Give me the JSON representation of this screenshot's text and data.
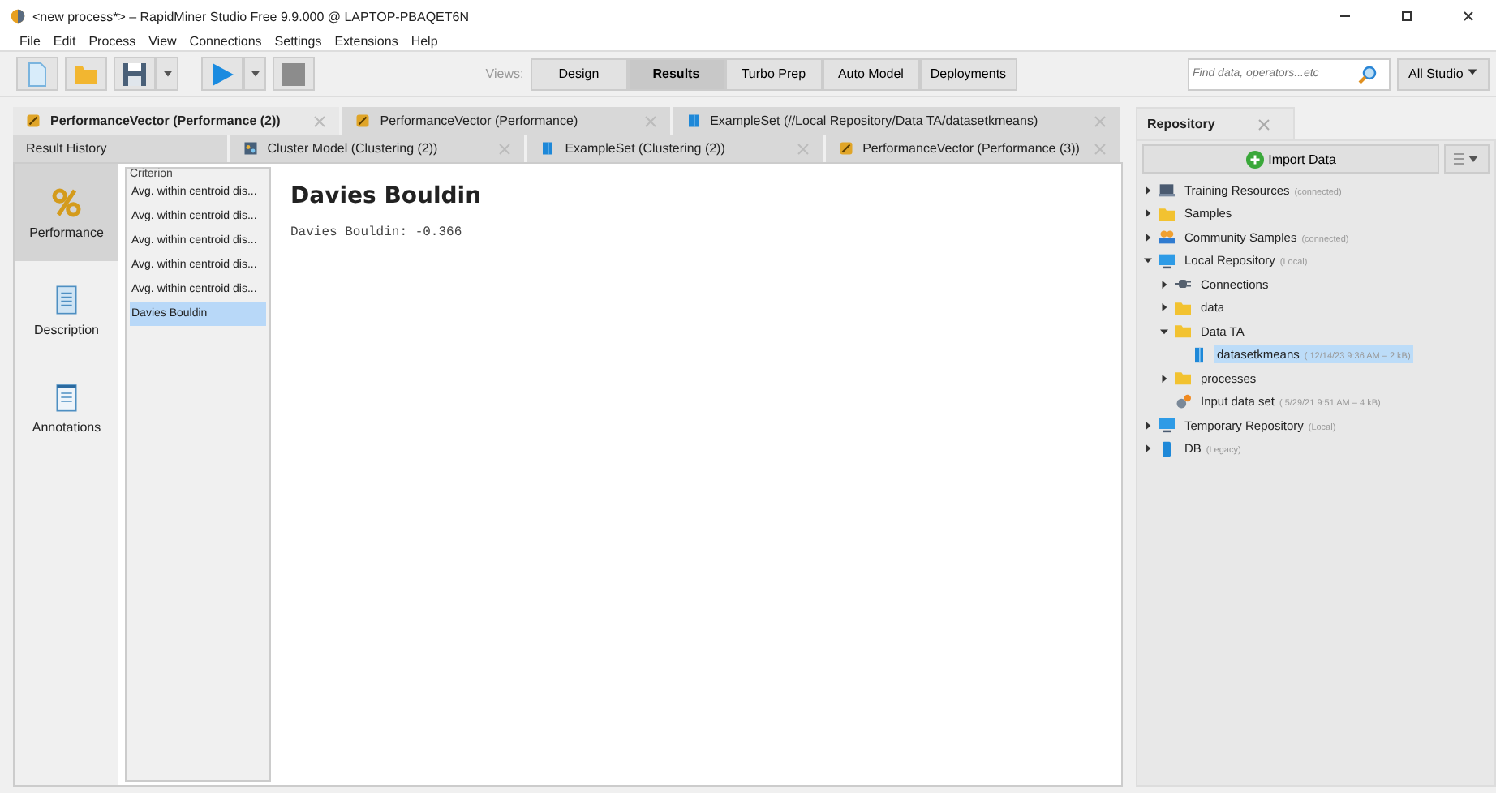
{
  "window": {
    "title": "<new process*> – RapidMiner Studio Free 9.9.000 @ LAPTOP-PBAQET6N"
  },
  "menu": [
    "File",
    "Edit",
    "Process",
    "View",
    "Connections",
    "Settings",
    "Extensions",
    "Help"
  ],
  "views": {
    "label": "Views:",
    "items": [
      {
        "label": "Design",
        "selected": false
      },
      {
        "label": "Results",
        "selected": true
      },
      {
        "label": "Turbo Prep",
        "selected": false
      },
      {
        "label": "Auto Model",
        "selected": false
      },
      {
        "label": "Deployments",
        "selected": false
      }
    ]
  },
  "search": {
    "placeholder": "Find data, operators...etc",
    "scope": "All Studio"
  },
  "result_tabs": [
    [
      {
        "label": "PerformanceVector (Performance (2))",
        "kind": "performance",
        "selected": true
      },
      {
        "label": "PerformanceVector (Performance)",
        "kind": "performance",
        "selected": false
      },
      {
        "label": "ExampleSet (//Local Repository/Data TA/datasetkmeans)",
        "kind": "data",
        "selected": false
      }
    ],
    [
      {
        "label": "Result History",
        "kind": "history",
        "selected": false
      },
      {
        "label": "Cluster Model (Clustering (2))",
        "kind": "cluster",
        "selected": false
      },
      {
        "label": "ExampleSet (Clustering (2))",
        "kind": "data",
        "selected": false
      },
      {
        "label": "PerformanceVector (Performance (3))",
        "kind": "performance",
        "selected": false
      }
    ]
  ],
  "side_views": [
    {
      "label": "Performance",
      "kind": "performance",
      "selected": true
    },
    {
      "label": "Description",
      "kind": "description",
      "selected": false
    },
    {
      "label": "Annotations",
      "kind": "annotations",
      "selected": false
    }
  ],
  "criterion": {
    "title": "Criterion",
    "items": [
      {
        "label": "Avg. within centroid dis...",
        "selected": false
      },
      {
        "label": "Avg. within centroid dis...",
        "selected": false
      },
      {
        "label": "Avg. within centroid dis...",
        "selected": false
      },
      {
        "label": "Avg. within centroid dis...",
        "selected": false
      },
      {
        "label": "Avg. within centroid dis...",
        "selected": false
      },
      {
        "label": "Davies Bouldin",
        "selected": true
      }
    ]
  },
  "result": {
    "heading": "Davies Bouldin",
    "value": "Davies Bouldin: -0.366"
  },
  "repository": {
    "title": "Repository",
    "import_button": "Import Data",
    "tree": [
      {
        "label": "Training Resources",
        "note": "(connected)",
        "kind": "server",
        "expanded": false,
        "selected": false
      },
      {
        "label": "Samples",
        "kind": "folder",
        "expanded": false,
        "selected": false
      },
      {
        "label": "Community Samples",
        "note": "(connected)",
        "kind": "people",
        "expanded": false,
        "selected": false
      },
      {
        "label": "Local Repository",
        "note": "(Local)",
        "kind": "monitor",
        "expanded": true,
        "selected": false,
        "children": [
          {
            "label": "Connections",
            "kind": "plug",
            "expanded": false,
            "selected": false
          },
          {
            "label": "data",
            "kind": "folder",
            "expanded": false,
            "selected": false
          },
          {
            "label": "Data TA",
            "kind": "folder",
            "expanded": true,
            "selected": false,
            "children": [
              {
                "label": "datasetkmeans",
                "note": "( 12/14/23 9:36 AM – 2 kB)",
                "kind": "data",
                "selected": true
              }
            ]
          },
          {
            "label": "processes",
            "kind": "folder",
            "expanded": false,
            "selected": false
          },
          {
            "label": "Input data set",
            "note": "( 5/29/21 9:51 AM – 4 kB)",
            "kind": "process",
            "selected": false
          }
        ]
      },
      {
        "label": "Temporary Repository",
        "note": "(Local)",
        "kind": "monitor",
        "expanded": false,
        "selected": false
      },
      {
        "label": "DB",
        "note": "(Legacy)",
        "kind": "db",
        "expanded": false,
        "selected": false
      }
    ]
  }
}
